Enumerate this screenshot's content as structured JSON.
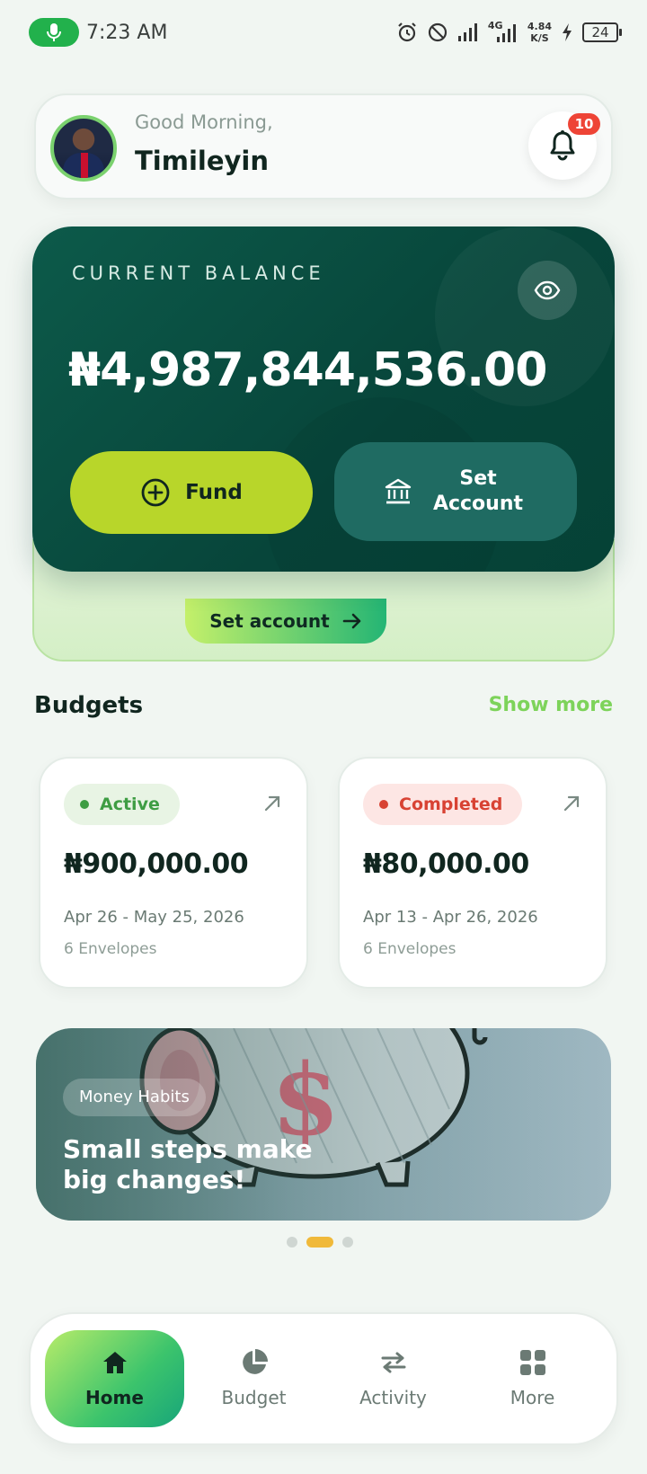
{
  "status_bar": {
    "time": "7:23 AM",
    "network_speed_value": "4.84",
    "network_speed_unit": "K/S",
    "network_type": "4G",
    "battery": "24"
  },
  "header": {
    "greeting": "Good Morning,",
    "username": "Timileyin",
    "notification_count": "10"
  },
  "balance_card": {
    "label": "CURRENT BALANCE",
    "amount": "₦4,987,844,536.00",
    "fund_label": "Fund",
    "set_account_label": "Set Account"
  },
  "promo_strip": {
    "button_label": "Set account"
  },
  "budgets": {
    "title": "Budgets",
    "show_more": "Show more",
    "items": [
      {
        "status": "Active",
        "amount": "₦900,000.00",
        "dates": "Apr 26 - May 25, 2026",
        "envelopes": "6 Envelopes"
      },
      {
        "status": "Completed",
        "amount": "₦80,000.00",
        "dates": "Apr 13 - Apr 26, 2026",
        "envelopes": "6 Envelopes"
      }
    ]
  },
  "promo_banner": {
    "tag": "Money Habits",
    "title": "Small steps make big changes!"
  },
  "carousel": {
    "total_pages": 3,
    "active_page": 2
  },
  "bottom_nav": {
    "items": [
      {
        "label": "Home",
        "icon": "home-icon",
        "active": true
      },
      {
        "label": "Budget",
        "icon": "pie-chart-icon",
        "active": false
      },
      {
        "label": "Activity",
        "icon": "transfer-arrows-icon",
        "active": false
      },
      {
        "label": "More",
        "icon": "grid-icon",
        "active": false
      }
    ]
  },
  "colors": {
    "brand_dark_green": "#07453a",
    "accent_lime": "#b8d62a",
    "link_green": "#7dd35a",
    "active_green": "#3e9d43",
    "completed_red": "#d84233",
    "badge_red": "#ee4436",
    "carousel_active": "#f0b93a"
  }
}
